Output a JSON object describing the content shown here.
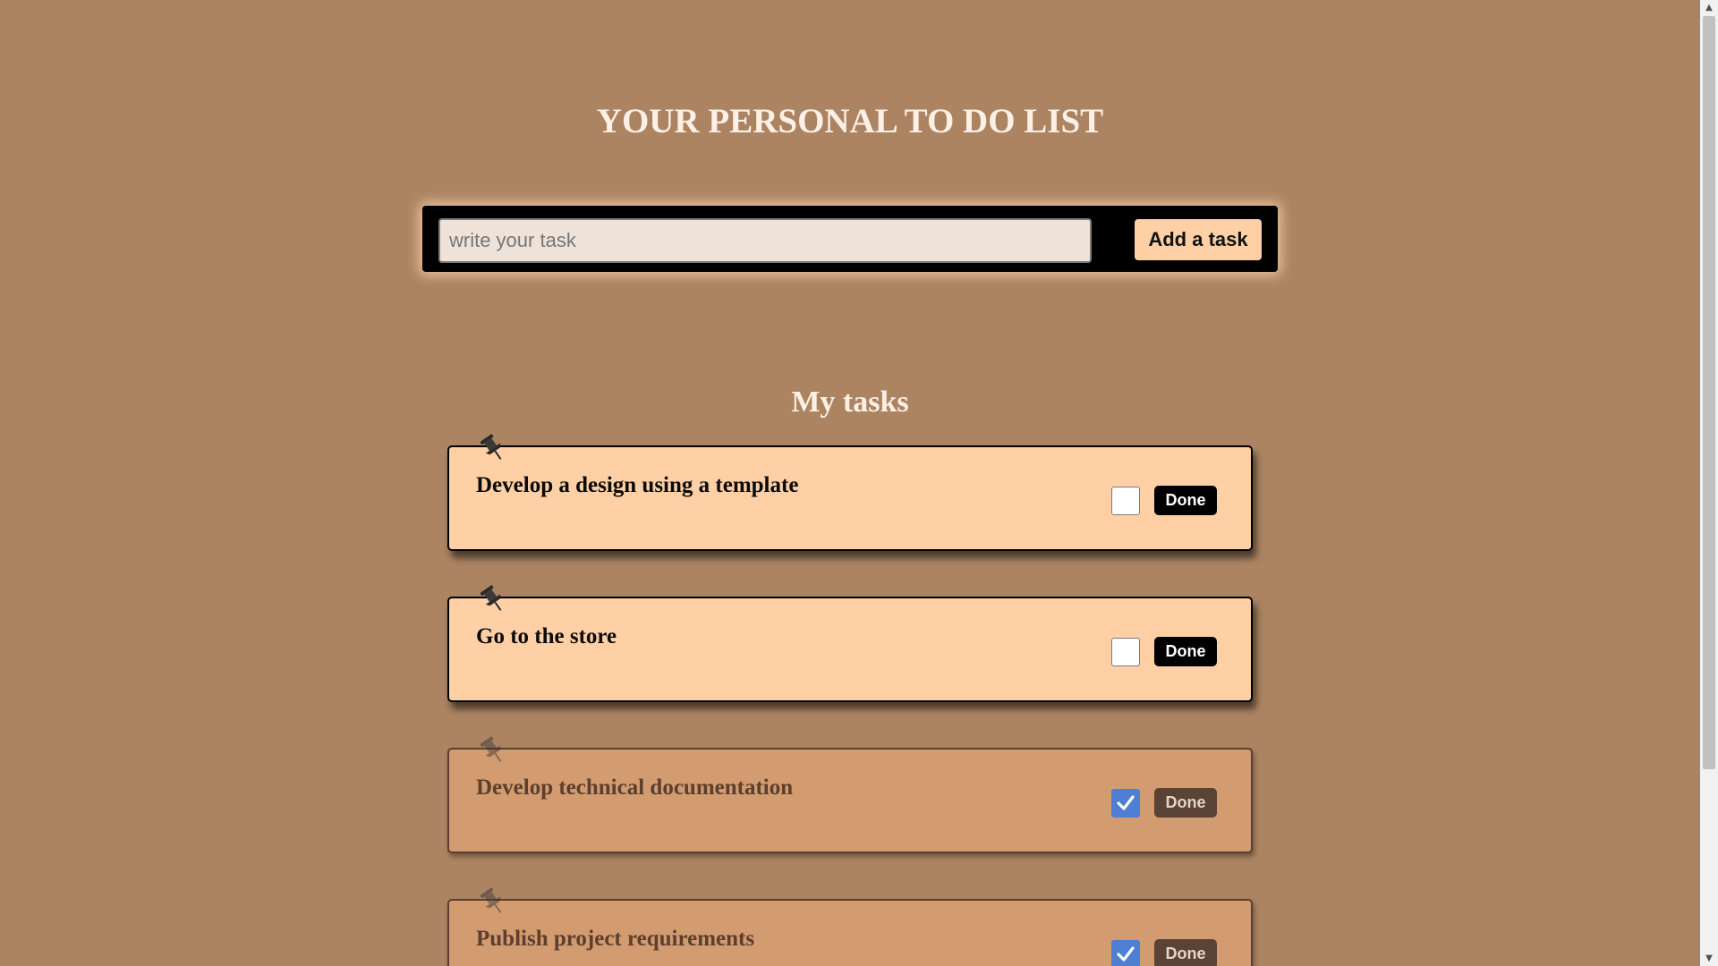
{
  "header": {
    "title": "YOUR PERSONAL TO DO LIST"
  },
  "add_task": {
    "placeholder": "write your task",
    "value": "",
    "button_label": "Add a task"
  },
  "tasks_section": {
    "title": "My tasks",
    "done_label": "Done",
    "items": [
      {
        "text": "Develop a design using a template",
        "completed": false
      },
      {
        "text": "Go to the store",
        "completed": false
      },
      {
        "text": "Develop technical documentation",
        "completed": true
      },
      {
        "text": "Publish project requirements",
        "completed": true
      }
    ]
  },
  "colors": {
    "background": "#ac8462",
    "card": "#ffd0a5",
    "card_done": "#d39b70",
    "checkbox_checked": "#4f7fd2"
  },
  "icons": {
    "pin": "pushpin-icon",
    "check": "checkmark-icon",
    "scroll_up": "scroll-up-arrow-icon",
    "scroll_down": "scroll-down-arrow-icon"
  }
}
